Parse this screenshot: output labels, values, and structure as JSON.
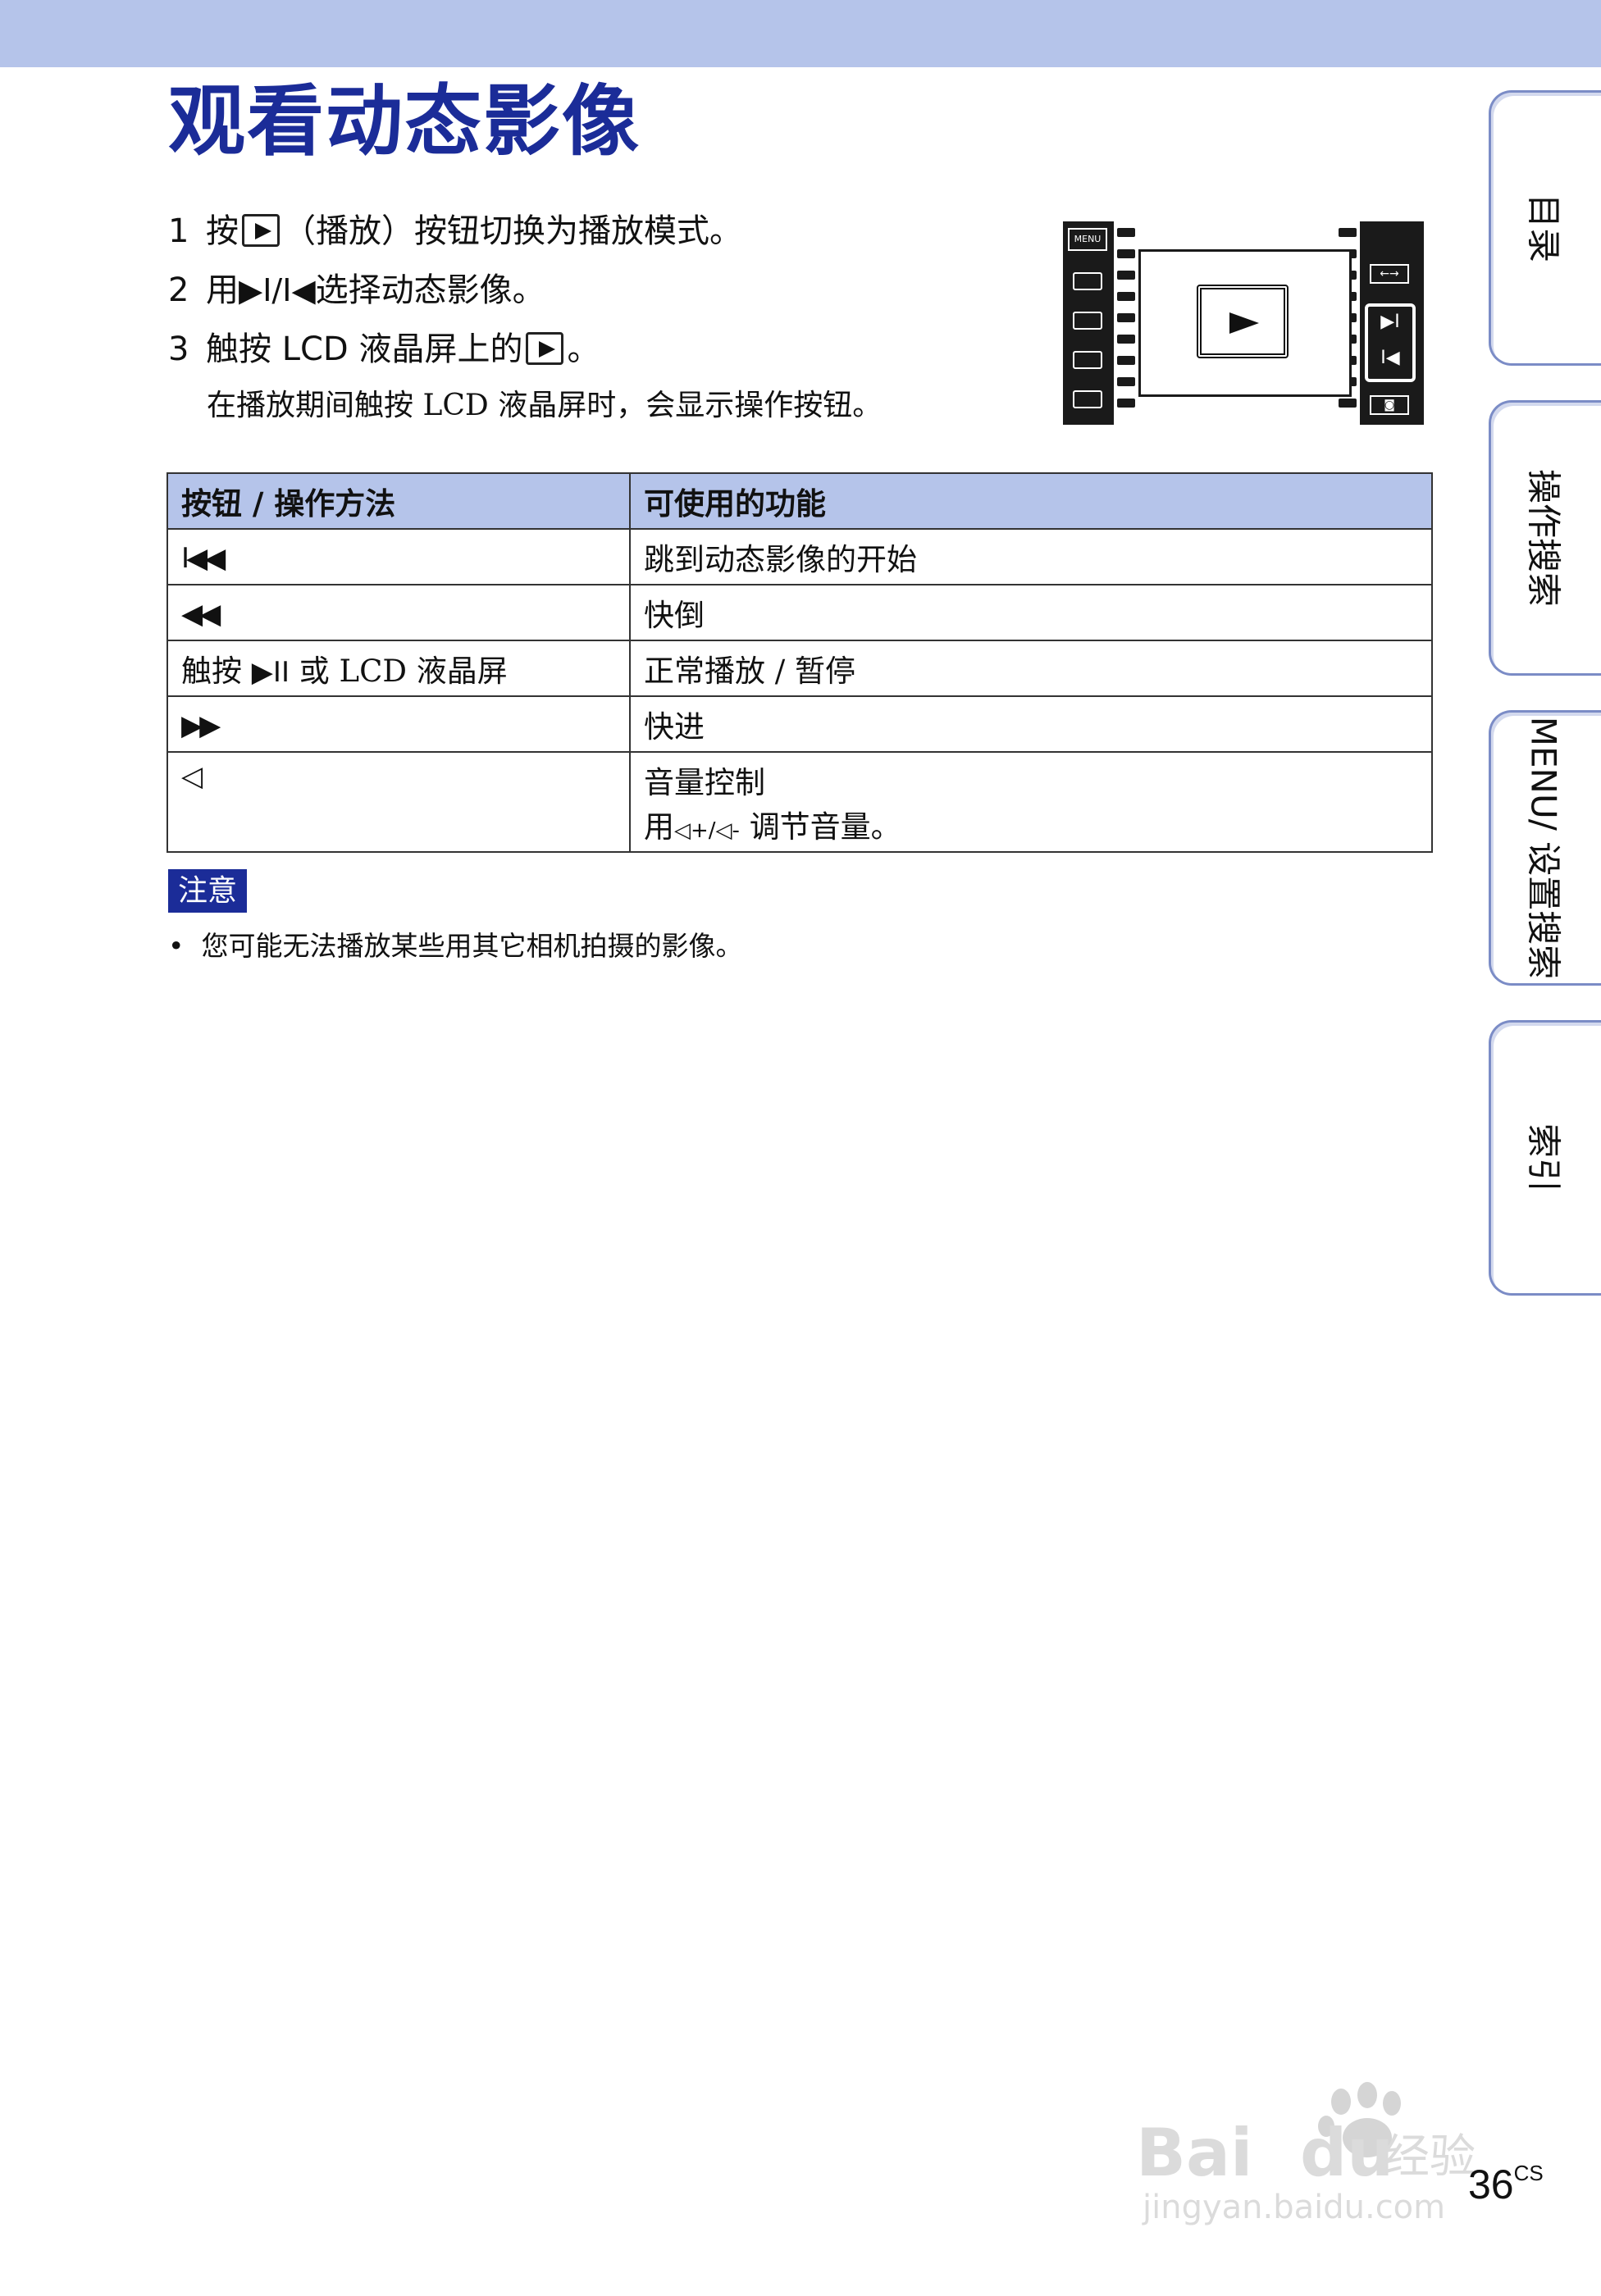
{
  "title": "观看动态影像",
  "steps": [
    {
      "num": "1",
      "text_before": "按",
      "text_after": "（播放）按钮切换为播放模式。"
    },
    {
      "num": "2",
      "text_before": "用",
      "glyphs": "▶I/I◀",
      "text_after": "选择动态影像。"
    },
    {
      "num": "3",
      "text_before": "触按 LCD 液晶屏上的",
      "text_after": "。",
      "sub": "在播放期间触按 LCD 液晶屏时，会显示操作按钮。"
    }
  ],
  "illustration": {
    "menu_label": "MENU",
    "resize_label": "←→"
  },
  "table": {
    "headers": [
      "按钮 / 操作方法",
      "可使用的功能"
    ],
    "rows": [
      {
        "glyph": "I◀◀",
        "label_before": "",
        "label_after": "",
        "function": "跳到动态影像的开始"
      },
      {
        "glyph": "◀◀",
        "label_before": "",
        "label_after": "",
        "function": "快倒"
      },
      {
        "glyph": "▶II",
        "label_before": "触按",
        "label_after": "或 LCD 液晶屏",
        "function": "正常播放 / 暂停"
      },
      {
        "glyph": "▶▶",
        "label_before": "",
        "label_after": "",
        "function": "快进"
      },
      {
        "glyph": "◁",
        "label_before": "",
        "label_after": "",
        "function": "音量控制",
        "function2_before": "用",
        "function2_glyph": "◁+/◁-",
        "function2_after": "调节音量。"
      }
    ]
  },
  "note": {
    "label": "注意",
    "items": [
      "您可能无法播放某些用其它相机拍摄的影像。"
    ]
  },
  "side_tabs": [
    "目录",
    "操作搜索",
    "MENU/ 设置搜索",
    "索引"
  ],
  "page": {
    "number": "36",
    "suffix": "CS"
  },
  "watermark": {
    "brand": "Bai",
    "brand2": "du",
    "cn": "经验",
    "url": "jingyan.baidu.com"
  },
  "colors": {
    "accent": "#1b2c98",
    "band": "#b5c4ea",
    "tab_border": "#7b8cc6"
  }
}
